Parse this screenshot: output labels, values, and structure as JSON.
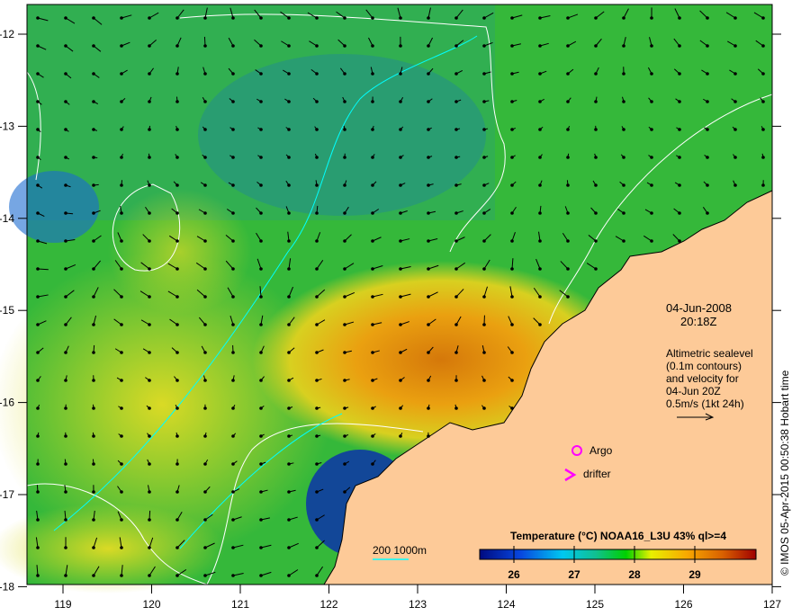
{
  "map": {
    "date": "04-Jun-2008",
    "time": "20:18Z",
    "legend_lines": [
      "Altimetric sealevel",
      "(0.1m contours)",
      "and velocity for",
      "04-Jun 20Z",
      "0.5m/s (1kt 24h)"
    ],
    "argo_label": "Argo",
    "drifter_label": "drifter",
    "bathy_label": "200  1000m",
    "colorbar_title": "Temperature (°C) NOAA16_L3U 43% ql>=4",
    "colorbar_ticks": [
      "26",
      "27",
      "28",
      "29"
    ],
    "credit": "© IMOS 05-Apr-2015 00:50:38 Hobart time",
    "lon_ticks": [
      "119",
      "120",
      "121",
      "122",
      "123",
      "124",
      "125",
      "126",
      "127"
    ],
    "lat_ticks": [
      "-12",
      "-13",
      "-14",
      "-15",
      "-16",
      "-17",
      "-18"
    ],
    "colors": {
      "land": "#fdca98",
      "argo": "#ff00ff",
      "bathy": "#00ffff",
      "contour": "#ffffff"
    }
  }
}
